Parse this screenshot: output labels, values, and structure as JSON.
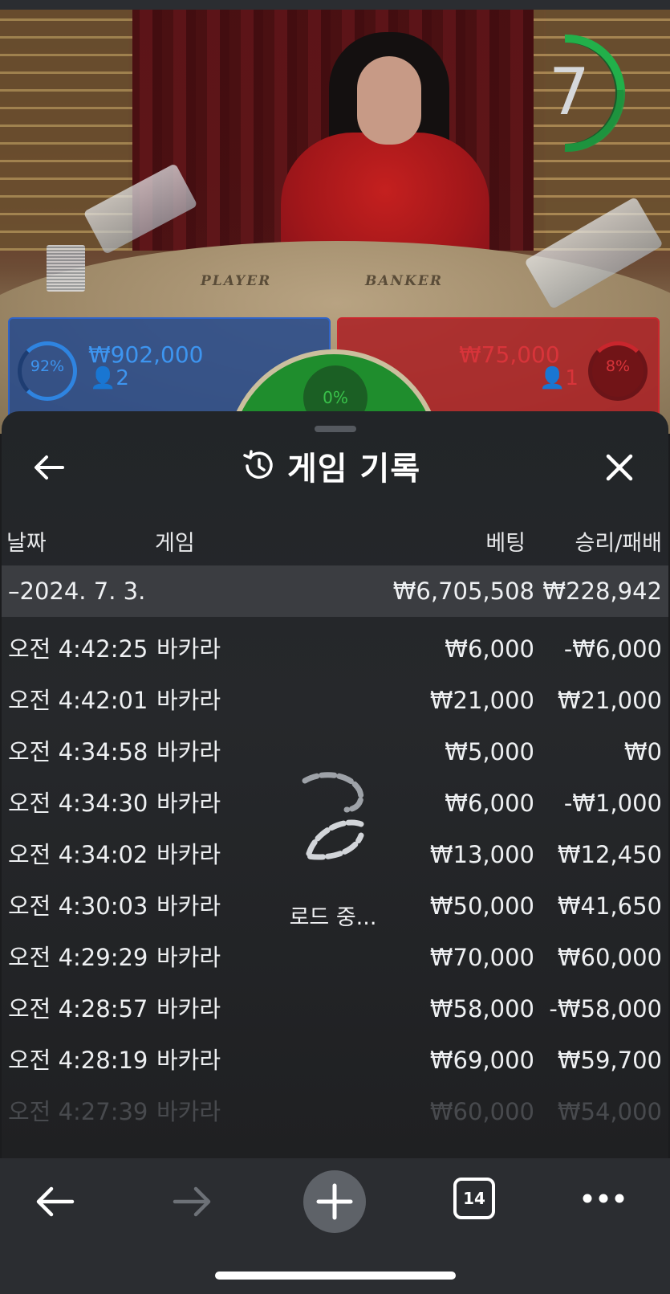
{
  "video": {
    "timer": "7",
    "table_labels": {
      "player": "PLAYER",
      "banker": "BANKER"
    }
  },
  "bets": {
    "player": {
      "percent": "92%",
      "amount": "₩902,000",
      "count": "2",
      "color": "#2f84e0"
    },
    "tie": {
      "percent": "0%",
      "color": "#39c24a"
    },
    "banker": {
      "percent": "8%",
      "amount": "₩75,000",
      "count": "1",
      "color": "#c9262d"
    }
  },
  "history": {
    "title": "게임 기록",
    "columns": {
      "date": "날짜",
      "game": "게임",
      "bet": "베팅",
      "winloss": "승리/패배"
    },
    "date_group": {
      "date": "–2024. 7. 3.",
      "bet_total": "₩6,705,508",
      "winloss_total": "₩228,942"
    },
    "rows": [
      {
        "time": "오전 4:42:25",
        "game": "바카라",
        "bet": "₩6,000",
        "winloss": "-₩6,000"
      },
      {
        "time": "오전 4:42:01",
        "game": "바카라",
        "bet": "₩21,000",
        "winloss": "₩21,000"
      },
      {
        "time": "오전 4:34:58",
        "game": "바카라",
        "bet": "₩5,000",
        "winloss": "₩0"
      },
      {
        "time": "오전 4:34:30",
        "game": "바카라",
        "bet": "₩6,000",
        "winloss": "-₩1,000"
      },
      {
        "time": "오전 4:34:02",
        "game": "바카라",
        "bet": "₩13,000",
        "winloss": "₩12,450"
      },
      {
        "time": "오전 4:30:03",
        "game": "바카라",
        "bet": "₩50,000",
        "winloss": "₩41,650"
      },
      {
        "time": "오전 4:29:29",
        "game": "바카라",
        "bet": "₩70,000",
        "winloss": "₩60,000"
      },
      {
        "time": "오전 4:28:57",
        "game": "바카라",
        "bet": "₩58,000",
        "winloss": "-₩58,000"
      },
      {
        "time": "오전 4:28:19",
        "game": "바카라",
        "bet": "₩69,000",
        "winloss": "₩59,700"
      },
      {
        "time": "오전 4:27:39",
        "game": "바카라",
        "bet": "₩60,000",
        "winloss": "₩54,000"
      }
    ],
    "loading_text": "로드 중..."
  },
  "browser": {
    "tab_count": "14",
    "icons": [
      "back-arrow-icon",
      "forward-arrow-icon",
      "plus-icon",
      "tabs-icon",
      "more-icon"
    ]
  }
}
